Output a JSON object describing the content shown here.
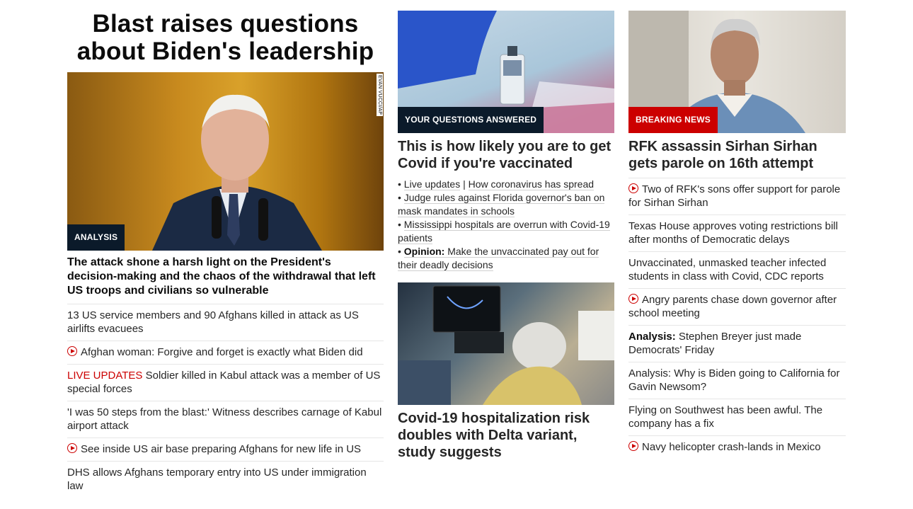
{
  "col1": {
    "headline": "Blast raises questions about Biden's leadership",
    "badge": "ANALYSIS",
    "photo_credit": "EVAN VUCCI/AP",
    "lead": "The attack shone a harsh light on the President's decision-making and the chaos of the withdrawal that left US troops and civilians so vulnerable",
    "items": [
      {
        "text": "13 US service members and 90 Afghans killed in attack as US airlifts evacuees"
      },
      {
        "text": "Afghan woman: Forgive and forget is exactly what Biden did",
        "icon": "play-icon"
      },
      {
        "prefix": "LIVE UPDATES",
        "text": "Soldier killed in Kabul attack was a member of US special forces"
      },
      {
        "text": "'I was 50 steps from the blast:' Witness describes carnage of Kabul airport attack"
      },
      {
        "text": "See inside US air base preparing Afghans for new life in US",
        "icon": "play-icon"
      },
      {
        "text": "DHS allows Afghans temporary entry into US under immigration law"
      }
    ]
  },
  "col2": {
    "card1": {
      "badge": "YOUR QUESTIONS ANSWERED",
      "title": "This is how likely you are to get Covid if you're vaccinated",
      "bullets": {
        "b1a": "Live updates",
        "b1sep": " | ",
        "b1b": "How coronavirus has spread",
        "b2": "Judge rules against Florida governor's ban on mask mandates in schools",
        "b3": "Mississippi hospitals are overrun with Covid-19 patients",
        "b4_prefix": "Opinion:",
        "b4": "Make the unvaccinated pay out for their deadly decisions"
      }
    },
    "card2": {
      "title": "Covid-19 hospitalization risk doubles with Delta variant, study suggests"
    }
  },
  "col3": {
    "badge": "BREAKING NEWS",
    "title": "RFK assassin Sirhan Sirhan gets parole on 16th attempt",
    "items": [
      {
        "text": "Two of RFK's sons offer support for parole for Sirhan Sirhan",
        "icon": "play-icon"
      },
      {
        "text": "Texas House approves voting restrictions bill after months of Democratic delays"
      },
      {
        "text": "Unvaccinated, unmasked teacher infected students in class with Covid, CDC reports"
      },
      {
        "text": "Angry parents chase down governor after school meeting",
        "icon": "play-icon"
      },
      {
        "prefix": "Analysis:",
        "text": "Stephen Breyer just made Democrats' Friday"
      },
      {
        "text": "Analysis: Why is Biden going to California for Gavin Newsom?"
      },
      {
        "text": "Flying on Southwest has been awful. The company has a fix"
      },
      {
        "text": "Navy helicopter crash-lands in Mexico",
        "icon": "play-icon"
      }
    ]
  },
  "colors": {
    "accent_red": "#cc0000",
    "badge_dark": "#0b1a2a",
    "text": "#262626",
    "divider": "#e6e6e6"
  }
}
